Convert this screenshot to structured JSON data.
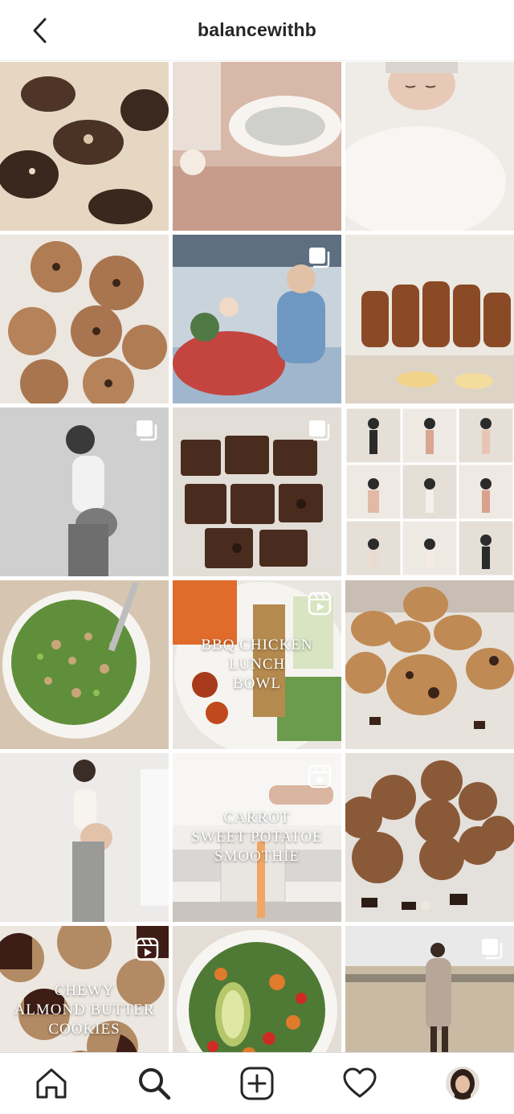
{
  "header": {
    "title": "balancewithb",
    "back_icon": "chevron-left-icon"
  },
  "grid": {
    "tiles": [
      {
        "name": "chocolate-bark",
        "badge": "",
        "text": ""
      },
      {
        "name": "baby-lounger",
        "badge": "",
        "text": ""
      },
      {
        "name": "newborn",
        "badge": "",
        "text": ""
      },
      {
        "name": "cookies",
        "badge": "",
        "text": ""
      },
      {
        "name": "mom-and-toddler",
        "badge": "multiple-photos-icon",
        "text": ""
      },
      {
        "name": "banana-bread",
        "badge": "",
        "text": ""
      },
      {
        "name": "pregnancy-bw",
        "badge": "multiple-photos-icon",
        "text": ""
      },
      {
        "name": "brownies",
        "badge": "multiple-photos-icon",
        "text": ""
      },
      {
        "name": "pregnancy-collage",
        "badge": "",
        "text": ""
      },
      {
        "name": "pea-salad",
        "badge": "",
        "text": ""
      },
      {
        "name": "bbq-chicken-bowl",
        "badge": "reels-icon",
        "text": "BBQ CHICKEN\nLUNCH\nBOWL"
      },
      {
        "name": "muffins",
        "badge": "",
        "text": ""
      },
      {
        "name": "pregnancy-standing",
        "badge": "",
        "text": ""
      },
      {
        "name": "smoothie",
        "badge": "reels-icon",
        "text": "CARROT\nSWEET POTATOE\nSMOOTHIE"
      },
      {
        "name": "energy-balls",
        "badge": "",
        "text": ""
      },
      {
        "name": "almond-butter-cookies",
        "badge": "reels-icon",
        "text": "CHEWY\nALMOND BUTTER\nCOOKIES"
      },
      {
        "name": "veggie-salad",
        "badge": "",
        "text": ""
      },
      {
        "name": "field-portrait",
        "badge": "multiple-photos-icon",
        "text": ""
      },
      {
        "name": "partial-1",
        "badge": "",
        "text": ""
      },
      {
        "name": "partial-2",
        "badge": "",
        "text": ""
      },
      {
        "name": "partial-3",
        "badge": "",
        "text": ""
      }
    ]
  },
  "tabbar": {
    "items": [
      {
        "name": "home",
        "icon": "home-icon"
      },
      {
        "name": "search",
        "icon": "search-icon"
      },
      {
        "name": "new-post",
        "icon": "add-post-icon"
      },
      {
        "name": "activity",
        "icon": "heart-icon"
      },
      {
        "name": "profile",
        "icon": "avatar"
      }
    ]
  }
}
